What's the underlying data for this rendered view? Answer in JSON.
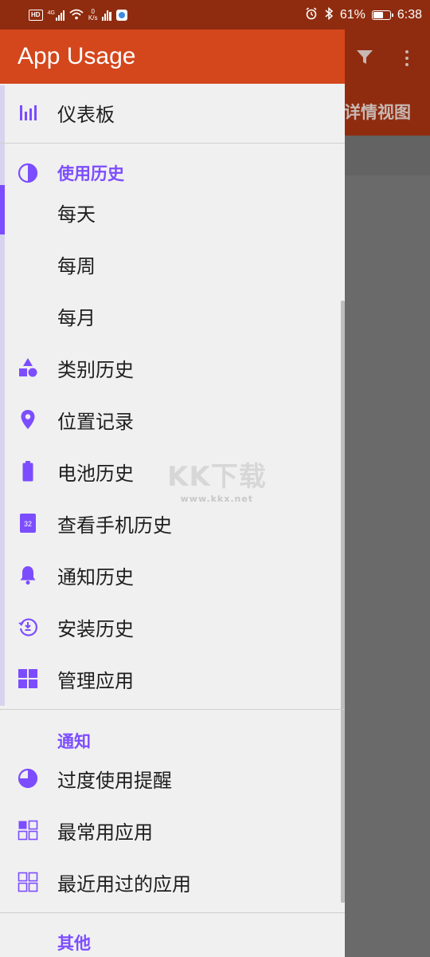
{
  "status_bar": {
    "network_badge": "HD",
    "network_type": "4G",
    "speed_value": "0",
    "speed_unit": "K/s",
    "battery_percent": "61%",
    "battery_level": 0.61,
    "time": "6:38"
  },
  "background_app": {
    "tab_label": "详情视图"
  },
  "drawer": {
    "title": "App Usage",
    "dashboard": "仪表板",
    "usage_history_section": "使用历史",
    "daily": "每天",
    "weekly": "每周",
    "monthly": "每月",
    "category_history": "类别历史",
    "location_records": "位置记录",
    "battery_history": "电池历史",
    "phone_check_history": "查看手机历史",
    "calendar_badge": "32",
    "notification_history": "通知历史",
    "install_history": "安装历史",
    "manage_apps": "管理应用",
    "notifications_section": "通知",
    "overuse_reminder": "过度使用提醒",
    "most_used_apps": "最常用应用",
    "recently_used_apps": "最近用过的应用",
    "other_section": "其他"
  },
  "watermark": {
    "main": "KK下载",
    "url": "www.kkx.net"
  },
  "colors": {
    "accent": "#7c4dff",
    "header": "#d4461c",
    "statusbar": "#8f2c0f"
  }
}
